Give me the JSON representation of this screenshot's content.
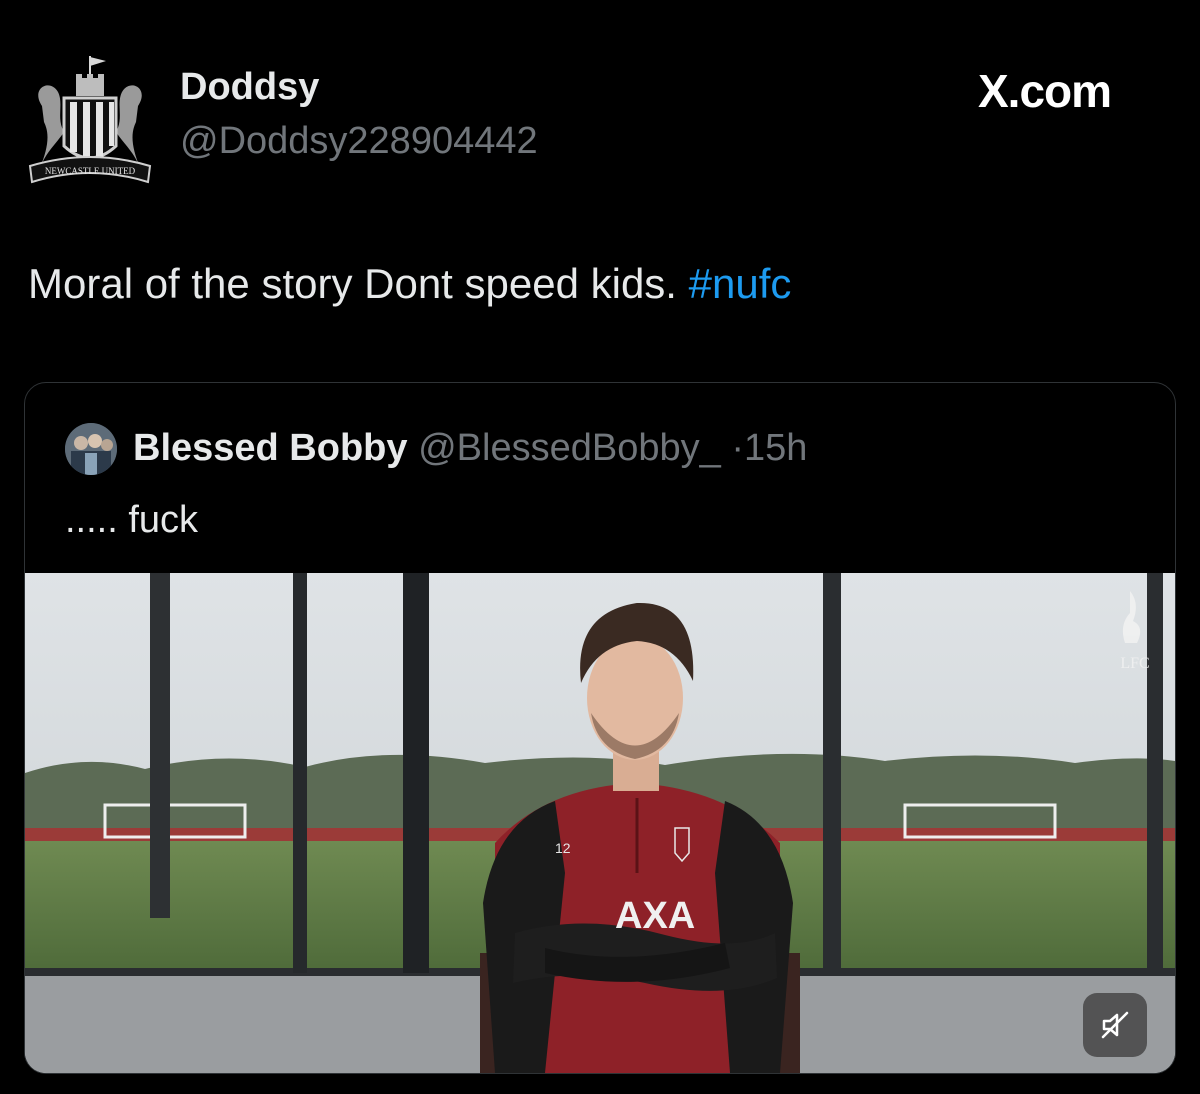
{
  "author": {
    "display_name": "Doddsy",
    "handle": "@Doddsy228904442",
    "avatar_icon": "newcastle-united-crest-icon",
    "avatar_text": "NEWCASTLE UNITED"
  },
  "brand": {
    "label": "X.com"
  },
  "tweet": {
    "text": "Moral of the story Dont speed kids.",
    "hashtag": "#nufc",
    "hashtag_color": "#1d9bf0"
  },
  "quoted_tweet": {
    "display_name": "Blessed Bobby",
    "handle": "@BlessedBobby_",
    "separator": "·",
    "time": "15h",
    "text": "..... fuck",
    "media": {
      "type": "video",
      "watermark_text": "LFC",
      "shirt_number": "12",
      "sponsor_text": "AXA",
      "mute_icon": "speaker-muted-icon"
    }
  },
  "colors": {
    "background": "#000000",
    "text_primary": "#e7e9ea",
    "text_secondary": "#71767b",
    "card_border": "#2f3336",
    "shirt_red": "#8e2128"
  }
}
